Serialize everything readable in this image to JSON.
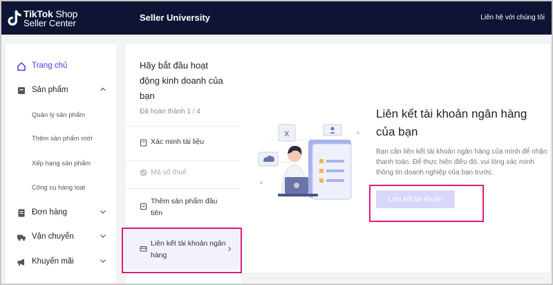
{
  "header": {
    "logo_line1_brand": "TikTok",
    "logo_line1_suffix": " Shop",
    "logo_line2": "Seller Center",
    "title": "Seller University",
    "contact": "Liên hệ với chúng tôi",
    "bg_color": "#0f1435"
  },
  "sidebar": {
    "items": [
      {
        "label": "Trang chủ",
        "icon": "home-icon",
        "active": true
      },
      {
        "label": "Sản phẩm",
        "icon": "product-icon",
        "expanded": true
      },
      {
        "label": "Đơn hàng",
        "icon": "order-icon"
      },
      {
        "label": "Vận chuyển",
        "icon": "truck-icon"
      },
      {
        "label": "Khuyến mãi",
        "icon": "megaphone-icon"
      }
    ],
    "sub_items": [
      "Quản lý sản phẩm",
      "Thêm sản phẩm mới",
      "Xếp hạng sản phẩm",
      "Công cụ hàng loạt"
    ]
  },
  "steps": {
    "title": "Hãy bắt đầu hoạt động kinh doanh của bạn",
    "progress": "Đã hoàn thành 1 / 4",
    "items": [
      {
        "label": "Xác minh tài liệu",
        "icon": "document-icon",
        "state": "pending"
      },
      {
        "label": "Mã số thuế",
        "icon": "check-circle-icon",
        "state": "done"
      },
      {
        "label": "Thêm sản phẩm đầu tiên",
        "icon": "box-icon",
        "state": "pending"
      },
      {
        "label": "Liên kết tài khoản ngân hàng",
        "icon": "card-icon",
        "state": "selected"
      }
    ]
  },
  "main": {
    "title": "Liên kết tài khoản ngân hàng của bạn",
    "description": "Bạn cần liên kết tài khoản ngân hàng của mình để nhận thanh toán. Để thực hiện điều đó, vui lòng xác minh thông tin doanh nghiệp của bạn trước.",
    "button_label": "Liên kết tài khoản",
    "accent_color": "#3c3ee0",
    "highlight_color": "#e2197a"
  }
}
